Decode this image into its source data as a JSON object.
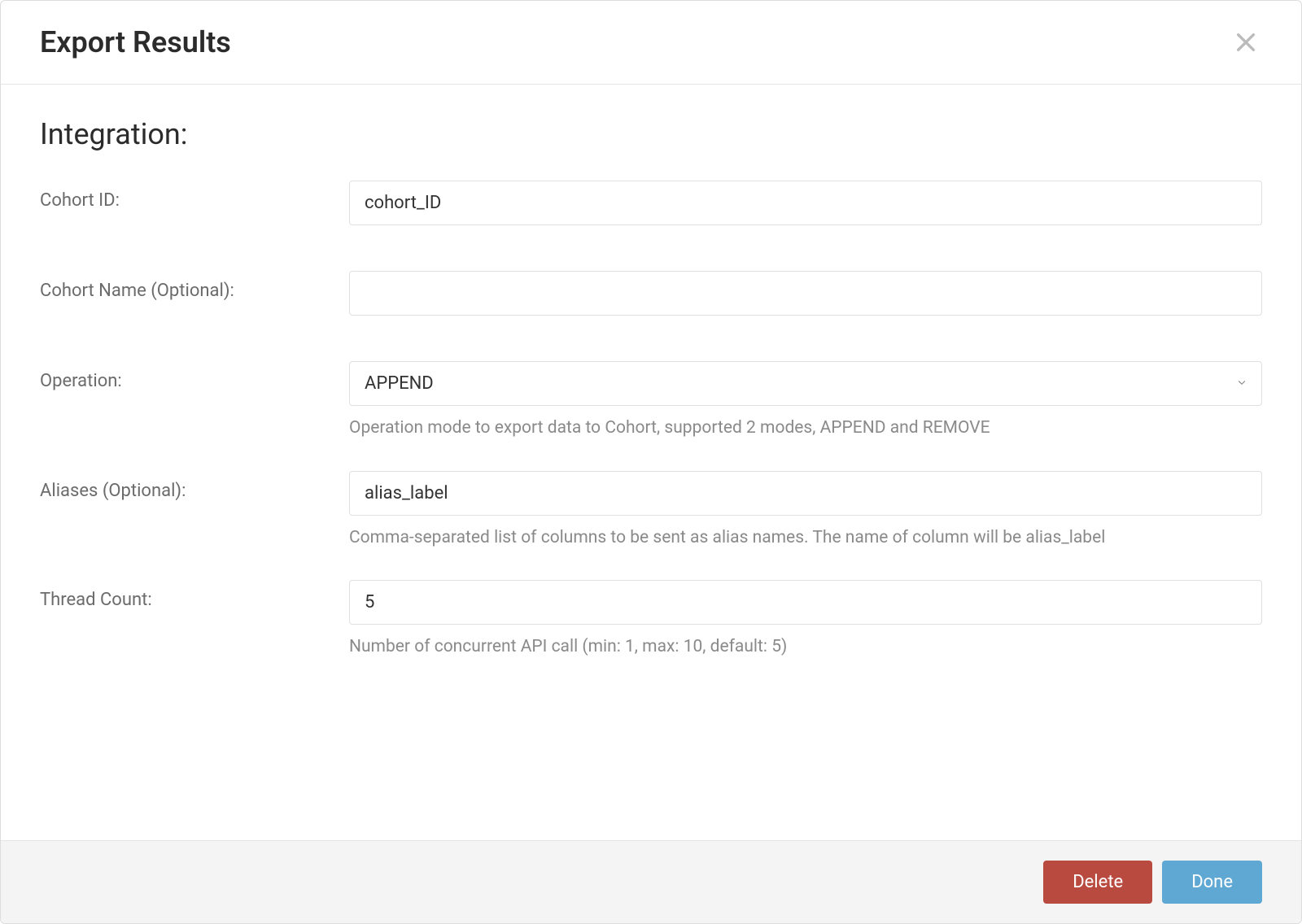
{
  "modal": {
    "title": "Export Results",
    "section_title": "Integration:",
    "fields": {
      "cohort_id": {
        "label": "Cohort ID:",
        "value": "cohort_ID"
      },
      "cohort_name": {
        "label": "Cohort Name (Optional):",
        "value": ""
      },
      "operation": {
        "label": "Operation:",
        "value": "APPEND",
        "help": "Operation mode to export data to Cohort, supported 2 modes, APPEND and REMOVE"
      },
      "aliases": {
        "label": "Aliases (Optional):",
        "value": "alias_label",
        "help": "Comma-separated list of columns to be sent as alias names. The name of column will be alias_label"
      },
      "thread_count": {
        "label": "Thread Count:",
        "value": "5",
        "help": "Number of concurrent API call (min: 1, max: 10, default: 5)"
      }
    },
    "footer": {
      "delete_label": "Delete",
      "done_label": "Done"
    }
  }
}
